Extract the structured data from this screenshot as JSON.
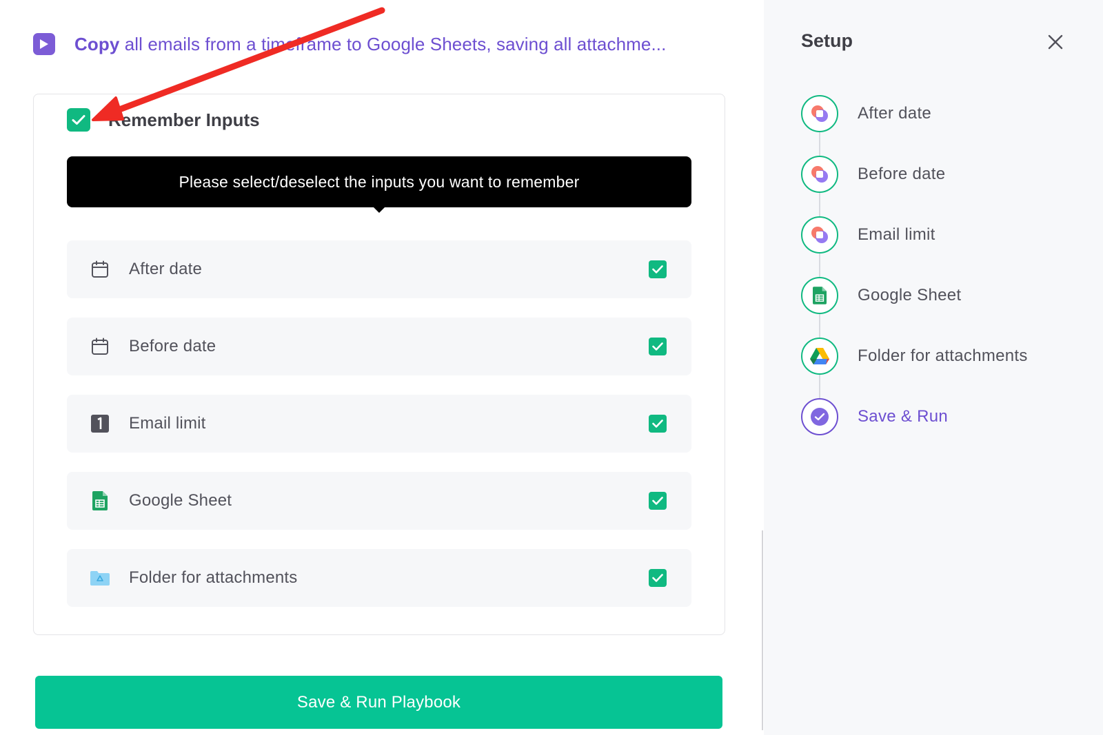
{
  "header": {
    "title_bold": "Copy",
    "title_rest": " all emails from a timeframe to Google Sheets, saving all attachme..."
  },
  "remember": {
    "label": "Remember Inputs",
    "checked": true
  },
  "tooltip": {
    "text": "Please select/deselect the inputs you want to remember"
  },
  "inputs": [
    {
      "label": "After date",
      "icon": "calendar-icon",
      "checked": true
    },
    {
      "label": "Before date",
      "icon": "calendar-icon",
      "checked": true
    },
    {
      "label": "Email limit",
      "icon": "number-one-icon",
      "checked": true
    },
    {
      "label": "Google Sheet",
      "icon": "google-sheets-icon",
      "checked": true
    },
    {
      "label": "Folder for attachments",
      "icon": "drive-folder-icon",
      "checked": true
    }
  ],
  "run_button": {
    "label": "Save & Run Playbook"
  },
  "setup": {
    "title": "Setup",
    "steps": [
      {
        "label": "After date",
        "icon": "app-logo-icon"
      },
      {
        "label": "Before date",
        "icon": "app-logo-icon"
      },
      {
        "label": "Email limit",
        "icon": "app-logo-icon"
      },
      {
        "label": "Google Sheet",
        "icon": "google-sheets-icon"
      },
      {
        "label": "Folder for attachments",
        "icon": "google-drive-icon"
      },
      {
        "label": "Save & Run",
        "icon": "check-circle-icon",
        "active": true
      }
    ]
  },
  "colors": {
    "accent_purple": "#6d4fd1",
    "accent_green": "#10b981",
    "button_green": "#06c494",
    "annotation_red": "#ef2b24"
  }
}
